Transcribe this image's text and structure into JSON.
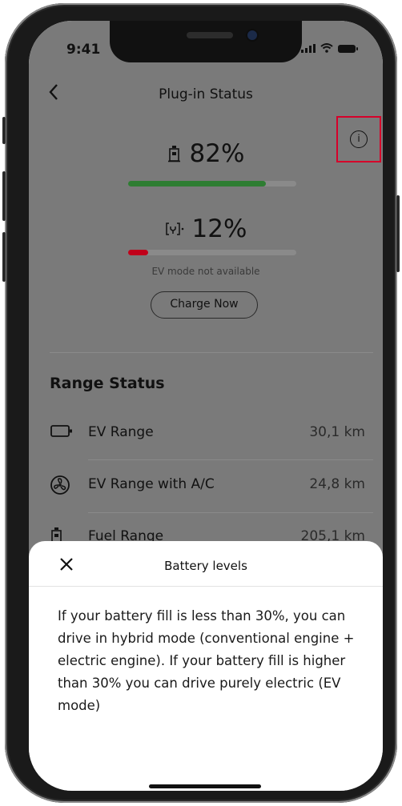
{
  "status_bar": {
    "time": "9:41"
  },
  "header": {
    "title": "Plug-in Status",
    "back_icon": "chevron-left-icon"
  },
  "info_button": {
    "icon": "info-icon",
    "highlight_color": "#d6002a"
  },
  "fuel": {
    "percent_text": "82%",
    "level": 0.82,
    "bar_color": "#2e7d32",
    "icon": "fuel-pump-icon"
  },
  "ev": {
    "percent_text": "12%",
    "level": 0.12,
    "bar_color": "#c0001a",
    "icon": "charging-plug-icon",
    "note": "EV mode not available"
  },
  "charge_button": {
    "label": "Charge Now"
  },
  "range": {
    "title": "Range Status",
    "items": [
      {
        "label": "EV Range",
        "value": "30,1 km",
        "icon": "battery-icon"
      },
      {
        "label": "EV Range with A/C",
        "value": "24,8 km",
        "icon": "fan-icon"
      },
      {
        "label": "Fuel Range",
        "value": "205,1 km",
        "icon": "fuel-pump-icon"
      }
    ]
  },
  "sheet": {
    "title": "Battery levels",
    "close_icon": "close-icon",
    "body": "If your battery fill is less than 30%, you can drive in hybrid mode (conventional engine + electric engine). If your battery fill is higher than 30% you can drive purely electric (EV mode)"
  }
}
